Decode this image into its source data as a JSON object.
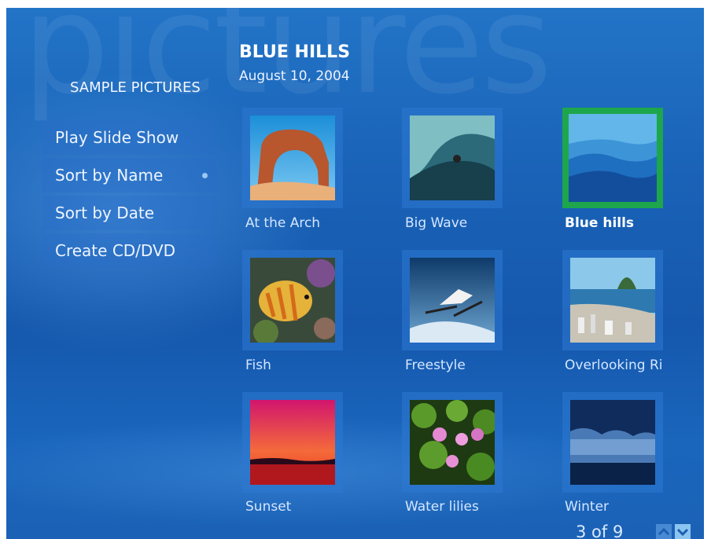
{
  "watermark": "pictures",
  "section_title": "SAMPLE PICTURES",
  "detail": {
    "title": "BLUE HILLS",
    "date": "August 10, 2004"
  },
  "menu": [
    {
      "label": "Play Slide Show"
    },
    {
      "label": "Sort by Name",
      "selected": true
    },
    {
      "label": "Sort by Date"
    },
    {
      "label": "Create CD/DVD"
    }
  ],
  "pictures": [
    {
      "caption": "At the Arch",
      "icon": "arch-photo"
    },
    {
      "caption": "Big Wave",
      "icon": "wave-photo"
    },
    {
      "caption": "Blue hills",
      "icon": "hills-photo",
      "selected": true
    },
    {
      "caption": "Fish",
      "icon": "fish-photo"
    },
    {
      "caption": "Freestyle",
      "icon": "skier-photo"
    },
    {
      "caption": "Overlooking Ri",
      "icon": "city-photo"
    },
    {
      "caption": "Sunset",
      "icon": "sunset-photo"
    },
    {
      "caption": "Water lilies",
      "icon": "lilies-photo"
    },
    {
      "caption": "Winter",
      "icon": "winter-photo"
    }
  ],
  "pager": {
    "text": "3 of 9",
    "up_icon": "chevron-up-icon",
    "down_icon": "chevron-down-icon"
  },
  "colors": {
    "selection": "#1ea64c",
    "background": "#1a63b8"
  }
}
